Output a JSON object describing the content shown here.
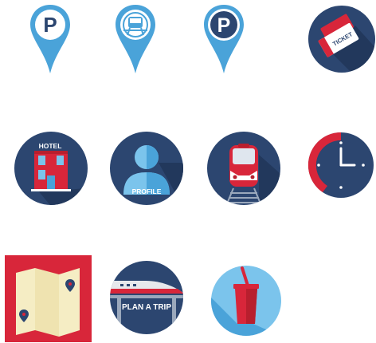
{
  "colors": {
    "navy": "#2c4670",
    "navy_shadow": "#22385c",
    "blue": "#4aa3d9",
    "light_blue": "#7bc4ec",
    "red": "#d8263a",
    "dark_red": "#b81f2e",
    "map_yellow": "#f5edc4",
    "white": "#ffffff"
  },
  "icons": [
    {
      "name": "parking-pin-icon",
      "letter": "P"
    },
    {
      "name": "station-pin-icon"
    },
    {
      "name": "parking-pin-dark-icon",
      "letter": "P"
    },
    {
      "name": "ticket-icon",
      "text": "TICKET"
    },
    {
      "name": "hotel-icon",
      "text": "HOTEL"
    },
    {
      "name": "profile-icon",
      "text": "PROFILE"
    },
    {
      "name": "train-icon"
    },
    {
      "name": "clock-icon"
    },
    {
      "name": "map-icon"
    },
    {
      "name": "plan-a-trip-icon",
      "text": "PLAN A TRIP"
    },
    {
      "name": "drink-cup-icon"
    }
  ]
}
